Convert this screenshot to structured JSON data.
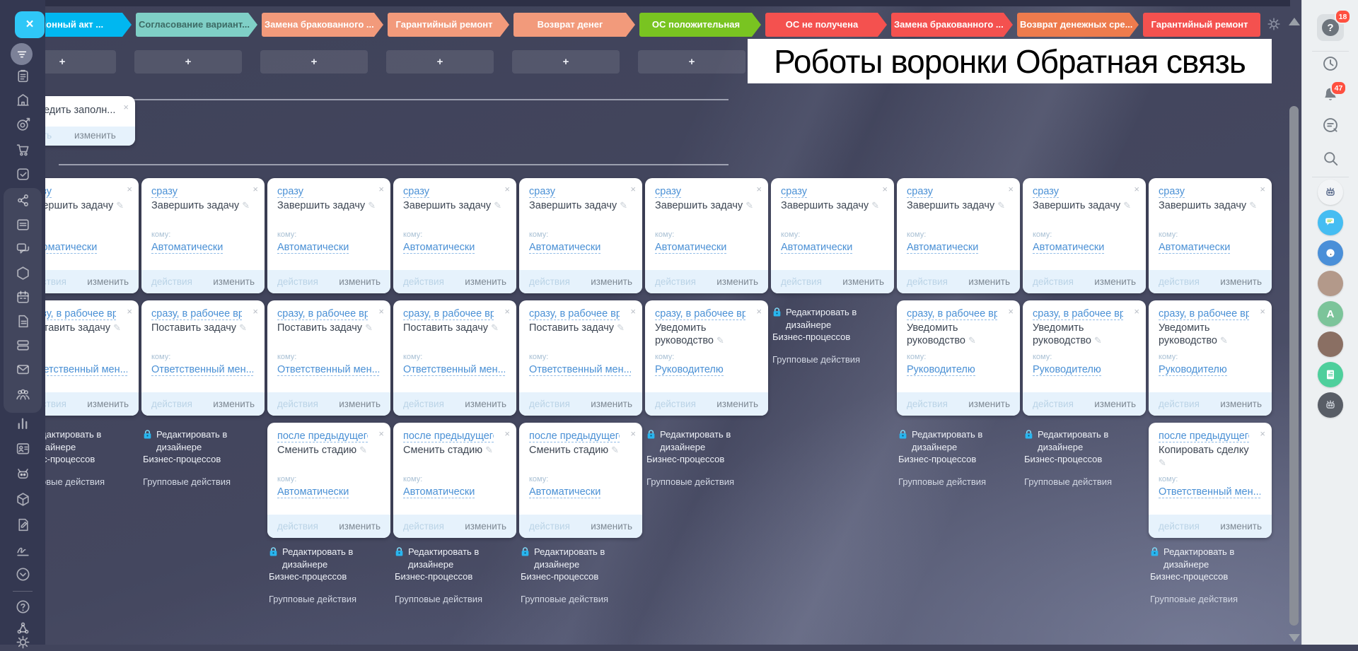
{
  "title_overlay": "Роботы воронки Обратная связь",
  "stages": [
    {
      "label": "ационный акт ...",
      "bg": "#00b7f0",
      "fg": "#ffffff",
      "arrow": true
    },
    {
      "label": "Согласование вариант...",
      "bg": "#7fcfc6",
      "fg": "#3c6b65",
      "arrow": true
    },
    {
      "label": "Замена бракованного ...",
      "bg": "#f29a7b",
      "fg": "#ffffff",
      "arrow": true
    },
    {
      "label": "Гарантийный ремонт",
      "bg": "#f29a7b",
      "fg": "#ffffff",
      "arrow": true
    },
    {
      "label": "Возврат денег",
      "bg": "#f29a7b",
      "fg": "#ffffff",
      "arrow": true
    },
    {
      "label": "ОС положительная",
      "bg": "#79c421",
      "fg": "#ffffff",
      "arrow": true
    },
    {
      "label": "ОС не получена",
      "bg": "#f4514f",
      "fg": "#ffffff",
      "arrow": true
    },
    {
      "label": "Замена бракованного ...",
      "bg": "#f4514f",
      "fg": "#ffffff",
      "arrow": true
    },
    {
      "label": "Возврат денежных сре...",
      "bg": "#ee7b4d",
      "fg": "#ffffff",
      "arrow": true
    },
    {
      "label": "Гарантийный ремонт",
      "bg": "#f4514f",
      "fg": "#ffffff",
      "arrow": false
    }
  ],
  "board": {
    "plus_label": "+",
    "to_label": "кому:",
    "close_label": "×",
    "pencil_glyph": "✎",
    "footer": {
      "actions": "действия",
      "edit": "изменить"
    },
    "lock_block": {
      "line1": "Редактировать в дизайнере",
      "line2": "Бизнес-процессов",
      "line3": "Групповые действия"
    },
    "partial_card": {
      "title": "едить заполн...",
      "close": "×",
      "footer_left": "ть",
      "footer_right": "изменить"
    },
    "columns": [
      {
        "row1": {
          "kind": "card",
          "when": "сразу",
          "action": "Завершить задачу",
          "to": "Автоматически"
        },
        "row2": {
          "kind": "card",
          "when": "сразу, в рабочее время",
          "action": "Поставить задачу",
          "to": "Ответственный мен..."
        },
        "row3": {
          "kind": "lock"
        },
        "row3_below": false
      },
      {
        "row1": {
          "kind": "card",
          "when": "сразу",
          "action": "Завершить задачу",
          "to": "Автоматически"
        },
        "row2": {
          "kind": "card",
          "when": "сразу, в рабочее время",
          "action": "Поставить задачу",
          "to": "Ответственный мен..."
        },
        "row3": {
          "kind": "lock"
        },
        "row3_below": false
      },
      {
        "row1": {
          "kind": "card",
          "when": "сразу",
          "action": "Завершить задачу",
          "to": "Автоматически"
        },
        "row2": {
          "kind": "card",
          "when": "сразу, в рабочее время",
          "action": "Поставить задачу",
          "to": "Ответственный мен..."
        },
        "row3": {
          "kind": "card",
          "when": "после предыдущего",
          "action": "Сменить стадию",
          "to": "Автоматически"
        },
        "row3_below": true
      },
      {
        "row1": {
          "kind": "card",
          "when": "сразу",
          "action": "Завершить задачу",
          "to": "Автоматически"
        },
        "row2": {
          "kind": "card",
          "when": "сразу, в рабочее время",
          "action": "Поставить задачу",
          "to": "Ответственный мен..."
        },
        "row3": {
          "kind": "card",
          "when": "после предыдущего",
          "action": "Сменить стадию",
          "to": "Автоматически"
        },
        "row3_below": true
      },
      {
        "row1": {
          "kind": "card",
          "when": "сразу",
          "action": "Завершить задачу",
          "to": "Автоматически"
        },
        "row2": {
          "kind": "card",
          "when": "сразу, в рабочее время",
          "action": "Поставить задачу",
          "to": "Ответственный мен..."
        },
        "row3": {
          "kind": "card",
          "when": "после предыдущего",
          "action": "Сменить стадию",
          "to": "Автоматически"
        },
        "row3_below": true
      },
      {
        "row1": {
          "kind": "card",
          "when": "сразу",
          "action": "Завершить задачу",
          "to": "Автоматически"
        },
        "row2": {
          "kind": "card",
          "when": "сразу, в рабочее время",
          "action": "Уведомить руководство",
          "to": "Руководителю"
        },
        "row3": {
          "kind": "lock"
        },
        "row3_below": false
      },
      {
        "row1": {
          "kind": "card",
          "when": "сразу",
          "action": "Завершить задачу",
          "to": "Автоматически"
        },
        "row2": {
          "kind": "lock"
        },
        "row3": null,
        "row3_below": false
      },
      {
        "row1": {
          "kind": "card",
          "when": "сразу",
          "action": "Завершить задачу",
          "to": "Автоматически"
        },
        "row2": {
          "kind": "card",
          "when": "сразу, в рабочее время",
          "action": "Уведомить руководство",
          "to": "Руководителю"
        },
        "row3": {
          "kind": "lock"
        },
        "row3_below": false
      },
      {
        "row1": {
          "kind": "card",
          "when": "сразу",
          "action": "Завершить задачу",
          "to": "Автоматически"
        },
        "row2": {
          "kind": "card",
          "when": "сразу, в рабочее время",
          "action": "Уведомить руководство",
          "to": "Руководителю"
        },
        "row3": {
          "kind": "lock"
        },
        "row3_below": false
      },
      {
        "row1": {
          "kind": "card",
          "when": "сразу",
          "action": "Завершить задачу",
          "to": "Автоматически"
        },
        "row2": {
          "kind": "card",
          "when": "сразу, в рабочее время",
          "action": "Уведомить руководство",
          "to": "Руководителю"
        },
        "row3": {
          "kind": "card",
          "when": "после предыдущего",
          "action": "Копировать сделку",
          "to": "Ответственный мен..."
        },
        "row3_below": true
      }
    ]
  },
  "sidebar": {
    "close_label": "×",
    "icons": [
      {
        "name": "tasks-icon"
      },
      {
        "name": "company-icon"
      },
      {
        "name": "crm-target-icon"
      },
      {
        "name": "shop-cart-icon"
      },
      {
        "name": "checkbox-icon"
      },
      {
        "name": "share-icon",
        "group": true
      },
      {
        "name": "feed-icon",
        "group": true
      },
      {
        "name": "chat-icon",
        "group": true
      },
      {
        "name": "sites-hexagon-icon",
        "group": true
      },
      {
        "name": "calendar-icon",
        "group": true
      },
      {
        "name": "documents-icon",
        "group": true
      },
      {
        "name": "drive-icon",
        "group": true
      },
      {
        "name": "mail-icon",
        "group": true
      },
      {
        "name": "employees-icon",
        "group": true
      },
      {
        "name": "analytics-icon"
      },
      {
        "name": "contacts-icon"
      },
      {
        "name": "automation-robot-icon"
      },
      {
        "name": "apps-cube-icon"
      },
      {
        "name": "docs-edit-icon"
      },
      {
        "name": "sign-icon"
      },
      {
        "name": "more-chevron-icon"
      },
      {
        "name": "help-icon"
      },
      {
        "name": "network-nodes-icon"
      },
      {
        "name": "settings-gear-icon"
      }
    ]
  },
  "right_rail": {
    "help_badge": "18",
    "bell_badge": "47",
    "icons": [
      {
        "name": "history-icon"
      },
      {
        "name": "bell-icon"
      },
      {
        "name": "dialog-icon"
      },
      {
        "name": "search-icon"
      }
    ],
    "avatars": [
      {
        "name": "bot-avatar",
        "bg": "#f2f4f6",
        "glyph": "robot",
        "glyph_color": "#5a6b8c"
      },
      {
        "name": "chat-bot-avatar",
        "bg": "#45bdf2",
        "glyph": "chat",
        "glyph_color": "#ffffff"
      },
      {
        "name": "dog-bot-avatar",
        "bg": "#4a8fd8",
        "glyph": "dog",
        "glyph_color": "#ffffff"
      },
      {
        "name": "user-avatar-man",
        "bg": "#b3998a",
        "glyph": "",
        "glyph_color": ""
      },
      {
        "name": "user-avatar-letter",
        "bg": "#7cc49a",
        "glyph": "A",
        "glyph_color": "#ffffff"
      },
      {
        "name": "user-avatar-woman",
        "bg": "#8a6f63",
        "glyph": "",
        "glyph_color": ""
      },
      {
        "name": "doc-bot-avatar",
        "bg": "#4ecf9c",
        "glyph": "doc",
        "glyph_color": "#ffffff"
      },
      {
        "name": "robot-dark-avatar",
        "bg": "#585d66",
        "glyph": "robot",
        "glyph_color": "#c9ced6"
      }
    ]
  },
  "colors": {
    "link": "#4a90d5",
    "lock_icon": "#29b6f0",
    "card_footer_bg": "#e6f2fc",
    "rail_bg": "#edf0f2",
    "sidebar_bg": "#343851",
    "board_bg": "#41445c"
  }
}
